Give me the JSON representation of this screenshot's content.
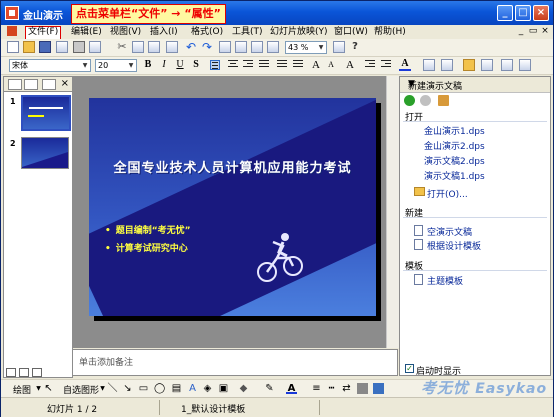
{
  "window": {
    "title": "金山演示",
    "hint": "点击菜单栏“文件” → “属性”"
  },
  "menu": {
    "items": [
      "文件(F)",
      "编辑(E)",
      "视图(V)",
      "插入(I)",
      "格式(O)",
      "工具(T)",
      "幻灯片放映(Y)",
      "窗口(W)",
      "帮助(H)"
    ]
  },
  "toolbar": {
    "zoom": "43 %"
  },
  "format_toolbar": {
    "font": "宋体",
    "size": "20",
    "bold": "B",
    "italic": "I",
    "underline": "U",
    "shadow": "S",
    "font_color": "A"
  },
  "slides_panel": {
    "numbers": [
      "1",
      "2"
    ]
  },
  "slide": {
    "title": "全国专业技术人员计算机应用能力考试",
    "bullets": [
      "题目编制“考无忧”",
      "计算考试研究中心"
    ]
  },
  "notes": {
    "placeholder": "单击添加备注"
  },
  "task_pane": {
    "title": "新建演示文稿",
    "open_heading": "打开",
    "recent_files": [
      "金山演示1.dps",
      "金山演示2.dps",
      "演示文稿2.dps",
      "演示文稿1.dps"
    ],
    "open_more": "打开(O)...",
    "new_heading": "新建",
    "new_items": [
      "空演示文稿",
      "根据设计模板"
    ],
    "template_heading": "模板",
    "template_items": [
      "主题模板"
    ],
    "startup_checkbox": "启动时显示",
    "startup_checked": true
  },
  "draw_toolbar": {
    "draw": "绘图",
    "autoshapes": "自选图形"
  },
  "status": {
    "slide_label": "幻灯片 1 / 2",
    "design": "1_默认设计模板"
  },
  "watermark": {
    "cn": "考无忧",
    "en": "Easykao"
  }
}
